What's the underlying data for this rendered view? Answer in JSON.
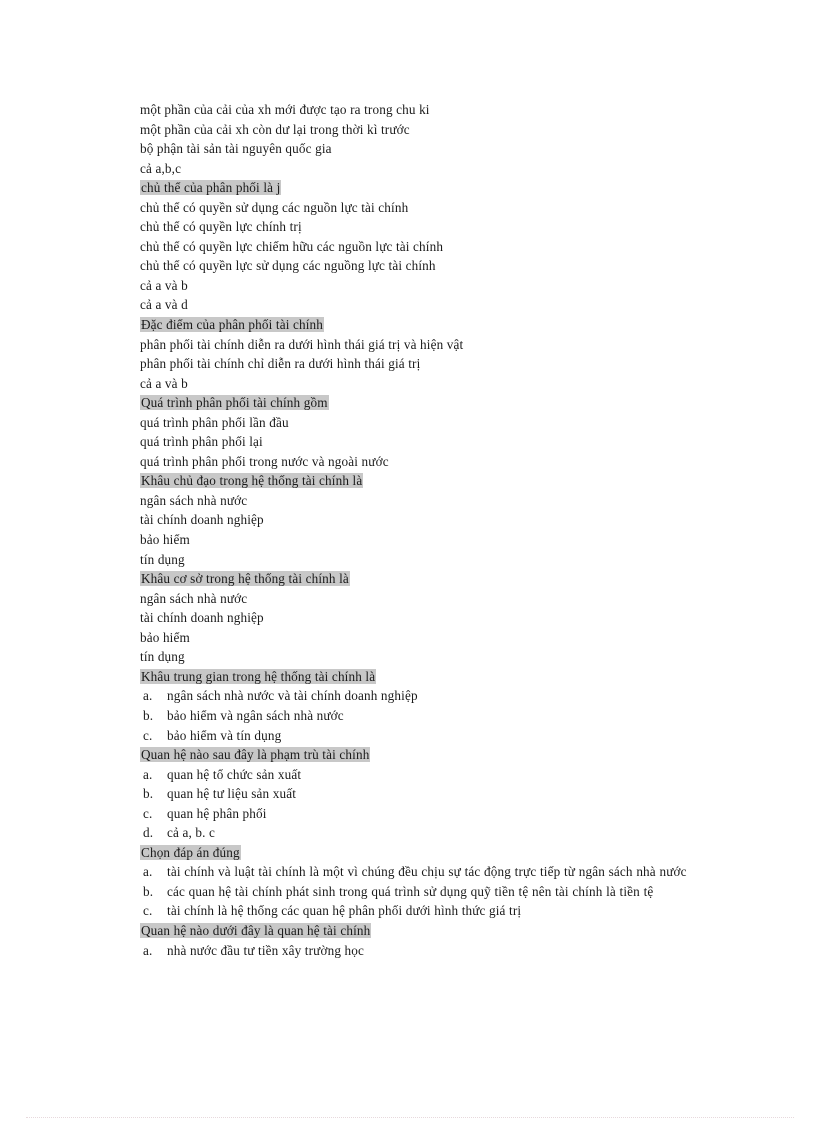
{
  "document": {
    "language": "vi",
    "highlight_color": "#c8c8c8",
    "text_color": "#1a1a1a",
    "page_background": "#ffffff",
    "rule_color": "#e3d3d8"
  },
  "blocks": [
    {
      "kind": "plain",
      "text": "một phần của cải của xh mới được tạo ra trong chu ki"
    },
    {
      "kind": "plain",
      "text": "một phần của cải xh còn dư lại trong thời kì trước"
    },
    {
      "kind": "plain",
      "text": "bộ phận tài sản tài nguyên  quốc gia"
    },
    {
      "kind": "plain",
      "text": "cả a,b,c"
    },
    {
      "kind": "heading",
      "text": " chủ thể của phân phối là j"
    },
    {
      "kind": "plain",
      "text": "chủ thể có quyền sử dụng các nguồn lực tài chính"
    },
    {
      "kind": "plain",
      "text": "chủ thể có quyền lực chính trị"
    },
    {
      "kind": "plain",
      "text": "chủ thể có quyền lực chiếm hữu các nguồn lực tài chính"
    },
    {
      "kind": "plain",
      "text": "chủ thể có quyền lực sử dụng các nguồng lực tài chính"
    },
    {
      "kind": "plain",
      "text": "cả a và b"
    },
    {
      "kind": "plain",
      "text": "cả a và d"
    },
    {
      "kind": "heading",
      "text": "Đặc điểm của phân phối tài chính"
    },
    {
      "kind": "plain",
      "text": "phân phối tài chính diễn ra dưới hình thái giá trị và hiện vật"
    },
    {
      "kind": "plain",
      "text": "phân phối tài chính chỉ diễn ra dưới hình thái giá trị"
    },
    {
      "kind": "plain",
      "text": "cả a và b"
    },
    {
      "kind": "heading",
      "text": " Quá trình phân phối tài chính  gồm"
    },
    {
      "kind": "plain",
      "text": "quá trình phân phối lần đầu"
    },
    {
      "kind": "plain",
      "text": "quá trình phân phối lại"
    },
    {
      "kind": "plain",
      "text": "quá trình phân phối trong nước và ngoài nước"
    },
    {
      "kind": "heading",
      "text": " Khâu chủ đạo trong hệ thống tài chính là"
    },
    {
      "kind": "plain",
      "text": "ngân sách nhà nước"
    },
    {
      "kind": "plain",
      "text": "tài chính doanh nghiệp"
    },
    {
      "kind": "plain",
      "text": "bảo hiểm"
    },
    {
      "kind": "plain",
      "text": "tín dụng"
    },
    {
      "kind": "heading",
      "text": " Khâu cơ sở trong hệ thống tài chính là"
    },
    {
      "kind": "plain",
      "text": "ngân sách nhà nước"
    },
    {
      "kind": "plain",
      "text": "tài chính doanh nghiệp"
    },
    {
      "kind": "plain",
      "text": "bảo hiểm"
    },
    {
      "kind": "plain",
      "text": "tín dụng"
    },
    {
      "kind": "heading",
      "text": " Khâu trung gian trong hệ thống tài chính là"
    },
    {
      "kind": "item",
      "marker": "a.",
      "text": "ngân sách nhà nước và tài chính doanh nghiệp"
    },
    {
      "kind": "item",
      "marker": "b.",
      "text": "bảo hiểm và ngân sách nhà nước"
    },
    {
      "kind": "item",
      "marker": "c.",
      "text": "bảo hiểm và tín dụng"
    },
    {
      "kind": "heading",
      "text": " Quan hệ nào sau đây là phạm trù tài chính"
    },
    {
      "kind": "item",
      "marker": "a.",
      "text": "quan hệ tổ chức sản xuất"
    },
    {
      "kind": "item",
      "marker": "b.",
      "text": "quan hệ tư liệu sản xuất"
    },
    {
      "kind": "item",
      "marker": "c.",
      "text": "quan hệ phân phối"
    },
    {
      "kind": "item",
      "marker": "d.",
      "text": "cả a, b. c"
    },
    {
      "kind": "heading",
      "text": "Chọn đáp án đúng"
    },
    {
      "kind": "item-wrap",
      "marker": "a.",
      "text": "tài chính và luật tài chính là một vì chúng đều chịu sự tác động trực tiếp từ ngân sách nhà nước"
    },
    {
      "kind": "item-wrap",
      "marker": "b.",
      "text": "các quan hệ tài chính phát sinh trong quá trình sử dụng quỹ tiền tệ nên tài chính là tiền tệ"
    },
    {
      "kind": "item",
      "marker": "c.",
      "text": "tài chính là hệ thống các quan hệ phân phối dưới hình thức giá trị"
    },
    {
      "kind": "heading",
      "text": "Quan hệ nào dưới đây là quan hệ tài chính"
    },
    {
      "kind": "item",
      "marker": "a.",
      "text": "nhà nước đầu tư tiền xây trường học"
    }
  ]
}
